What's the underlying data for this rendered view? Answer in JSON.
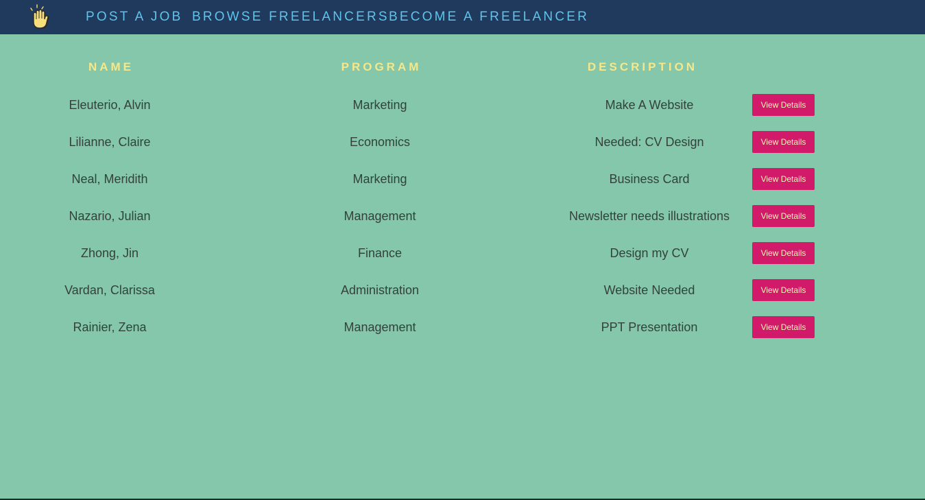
{
  "nav": {
    "logo_icon": "waving-hand-icon",
    "links": [
      "POST A JOB",
      "BROWSE FREELANCERS",
      "BECOME A FREELANCER"
    ]
  },
  "table": {
    "headers": {
      "name": "NAME",
      "program": "PROGRAM",
      "description": "DESCRIPTION"
    },
    "rows": [
      {
        "name": "Eleuterio, Alvin",
        "program": "Marketing",
        "description": "Make A Website",
        "button": "View Details"
      },
      {
        "name": "Lilianne, Claire",
        "program": "Economics",
        "description": "Needed: CV Design",
        "button": "View Details"
      },
      {
        "name": "Neal, Meridith",
        "program": "Marketing",
        "description": "Business Card",
        "button": "View Details"
      },
      {
        "name": "Nazario, Julian",
        "program": "Management",
        "description": "Newsletter needs illustrations",
        "button": "View Details"
      },
      {
        "name": "Zhong, Jin",
        "program": "Finance",
        "description": "Design my CV",
        "button": "View Details"
      },
      {
        "name": "Vardan, Clarissa",
        "program": "Administration",
        "description": "Website Needed",
        "button": "View Details"
      },
      {
        "name": "Rainier, Zena",
        "program": "Management",
        "description": "PPT Presentation",
        "button": "View Details"
      }
    ]
  },
  "colors": {
    "navbar_bg": "#1f3a5c",
    "page_bg": "#84c7aa",
    "nav_link": "#5fc4ec",
    "header_text": "#f6e88a",
    "button_bg": "#d11a69",
    "button_text": "#f9f3b8"
  }
}
